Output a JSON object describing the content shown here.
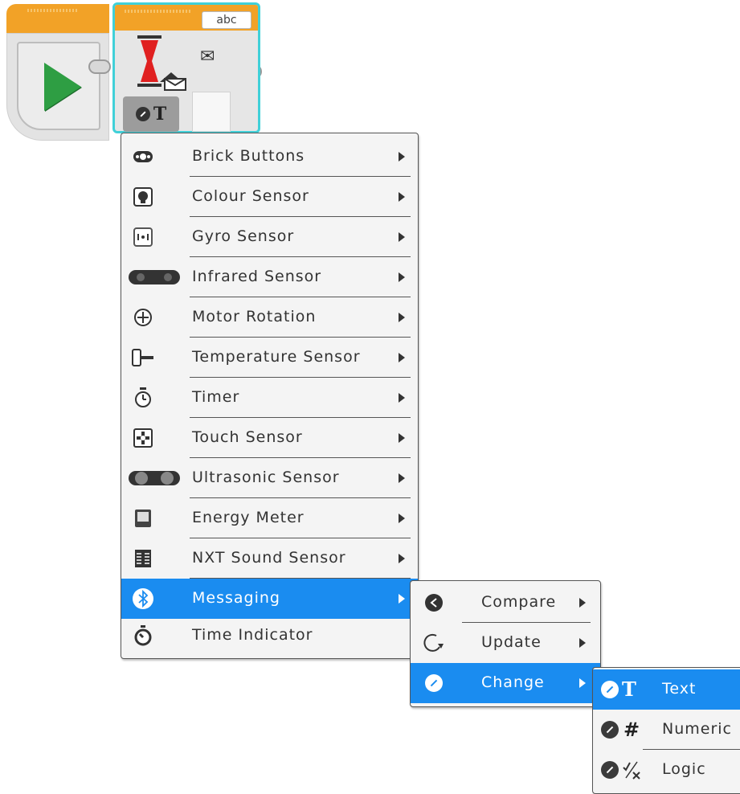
{
  "blocks": {
    "message_block_label": "abc"
  },
  "main_menu": {
    "items": [
      {
        "label": "Brick Buttons",
        "icon": "brick-buttons-icon",
        "has_submenu": true
      },
      {
        "label": "Colour Sensor",
        "icon": "colour-sensor-icon",
        "has_submenu": true
      },
      {
        "label": "Gyro Sensor",
        "icon": "gyro-sensor-icon",
        "has_submenu": true
      },
      {
        "label": "Infrared Sensor",
        "icon": "infrared-sensor-icon",
        "has_submenu": true
      },
      {
        "label": "Motor Rotation",
        "icon": "motor-rotation-icon",
        "has_submenu": true
      },
      {
        "label": "Temperature Sensor",
        "icon": "temperature-sensor-icon",
        "has_submenu": true
      },
      {
        "label": "Timer",
        "icon": "timer-icon",
        "has_submenu": true
      },
      {
        "label": "Touch Sensor",
        "icon": "touch-sensor-icon",
        "has_submenu": true
      },
      {
        "label": "Ultrasonic Sensor",
        "icon": "ultrasonic-sensor-icon",
        "has_submenu": true
      },
      {
        "label": "Energy Meter",
        "icon": "energy-meter-icon",
        "has_submenu": true
      },
      {
        "label": "NXT Sound Sensor",
        "icon": "nxt-sound-sensor-icon",
        "has_submenu": true
      },
      {
        "label": "Messaging",
        "icon": "bluetooth-icon",
        "has_submenu": true,
        "selected": true
      },
      {
        "label": "Time Indicator",
        "icon": "time-indicator-icon",
        "has_submenu": false
      }
    ]
  },
  "messaging_menu": {
    "items": [
      {
        "label": "Compare",
        "icon": "compare-icon"
      },
      {
        "label": "Update",
        "icon": "update-icon"
      },
      {
        "label": "Change",
        "icon": "change-icon",
        "selected": true
      }
    ]
  },
  "change_menu": {
    "items": [
      {
        "label": "Text",
        "icon": "text-icon",
        "selected": true
      },
      {
        "label": "Numeric",
        "icon": "numeric-icon"
      },
      {
        "label": "Logic",
        "icon": "logic-icon"
      }
    ]
  },
  "colors": {
    "selection": "#1a8cf0",
    "block_header": "#f2a227",
    "block_highlight": "#40d0d8",
    "play_green": "#2e9e43"
  }
}
